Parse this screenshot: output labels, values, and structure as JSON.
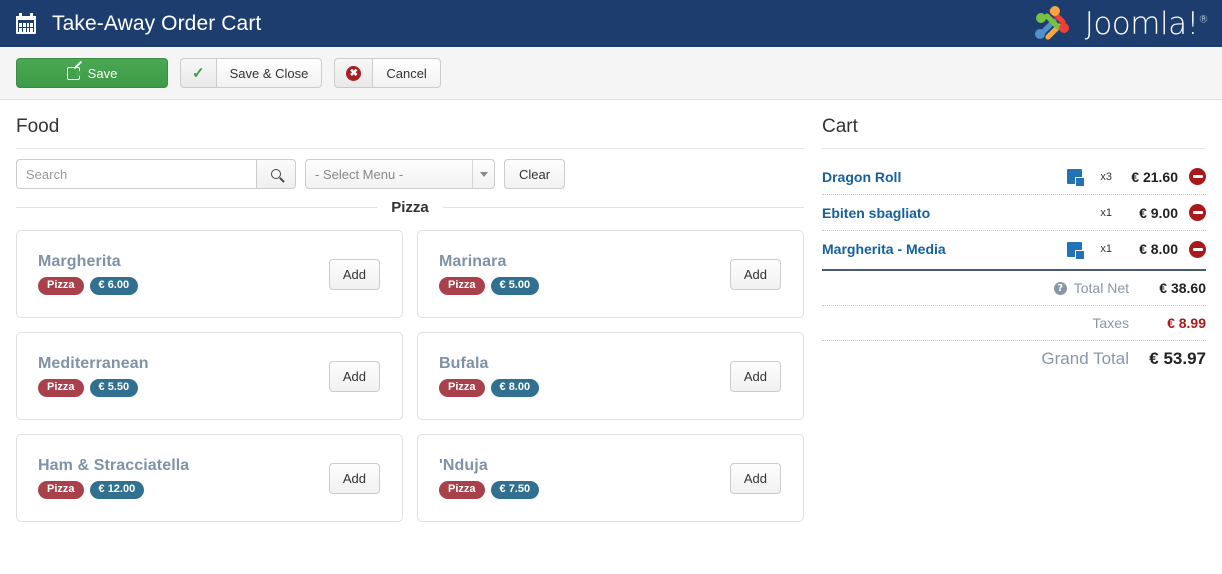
{
  "header": {
    "icon": "calendar-icon",
    "title": "Take-Away Order Cart",
    "brand_text": "Joomla!",
    "brand_sup": "®",
    "bg_color": "#1c3d6e"
  },
  "toolbar": {
    "save_label": "Save",
    "save_close_label": "Save & Close",
    "cancel_label": "Cancel",
    "save_color": "#3d9b47",
    "cancel_icon_color": "#a61f22"
  },
  "food_panel": {
    "title": "Food",
    "search": {
      "placeholder": "Search",
      "value": "",
      "button_icon": "search-icon"
    },
    "menu_select": {
      "selected": "- Select Menu -",
      "options": [
        "- Select Menu -"
      ]
    },
    "clear_label": "Clear",
    "category_heading": "Pizza",
    "items": [
      {
        "name": "Margherita",
        "category": "Pizza",
        "price": "€ 6.00",
        "add_label": "Add"
      },
      {
        "name": "Marinara",
        "category": "Pizza",
        "price": "€ 5.00",
        "add_label": "Add"
      },
      {
        "name": "Mediterranean",
        "category": "Pizza",
        "price": "€ 5.50",
        "add_label": "Add"
      },
      {
        "name": "Bufala",
        "category": "Pizza",
        "price": "€ 8.00",
        "add_label": "Add"
      },
      {
        "name": "Ham & Stracciatella",
        "category": "Pizza",
        "price": "€ 12.00",
        "add_label": "Add"
      },
      {
        "name": "'Nduja",
        "category": "Pizza",
        "price": "€ 7.50",
        "add_label": "Add"
      }
    ],
    "badge_category_color": "#a8414b",
    "badge_price_color": "#31708f"
  },
  "cart_panel": {
    "title": "Cart",
    "items": [
      {
        "name": "Dragon Roll",
        "has_note": true,
        "qty": "x3",
        "price": "€ 21.60",
        "remove_icon": "remove-circle-icon"
      },
      {
        "name": "Ebiten sbagliato",
        "has_note": false,
        "qty": "x1",
        "price": "€ 9.00",
        "remove_icon": "remove-circle-icon"
      },
      {
        "name": "Margherita - Media",
        "has_note": true,
        "qty": "x1",
        "price": "€ 8.00",
        "remove_icon": "remove-circle-icon"
      }
    ],
    "totals": [
      {
        "label": "Total Net",
        "value": "€ 38.60",
        "has_help": true,
        "red": false,
        "big": false
      },
      {
        "label": "Taxes",
        "value": "€ 8.99",
        "has_help": false,
        "red": true,
        "big": false
      },
      {
        "label": "Grand Total",
        "value": "€ 53.97",
        "has_help": false,
        "red": false,
        "big": true
      }
    ],
    "link_color": "#14619c",
    "remove_color": "#a9191c"
  }
}
